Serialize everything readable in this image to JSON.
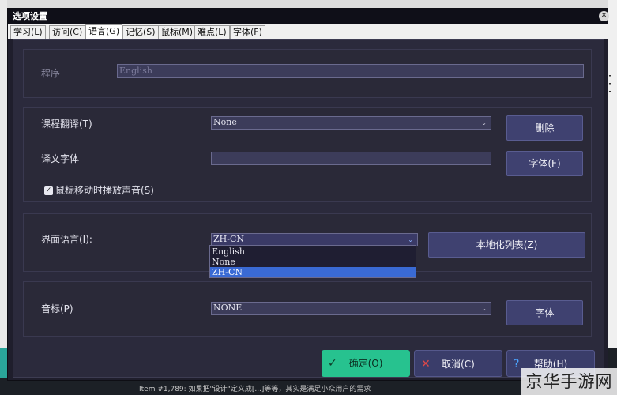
{
  "dialog": {
    "title": "选项设置"
  },
  "tabs": [
    {
      "label": "学习(L)"
    },
    {
      "label": "访问(C)"
    },
    {
      "label": "语言(G)",
      "active": true
    },
    {
      "label": "记忆(S)"
    },
    {
      "label": "鼠标(M)"
    },
    {
      "label": "难点(L)"
    },
    {
      "label": "字体(F)"
    }
  ],
  "program": {
    "label": "程序",
    "value": "English"
  },
  "translation": {
    "course_label": "课程翻译(T)",
    "course_value": "None",
    "delete_button": "删除",
    "font_label": "译文字体",
    "font_value": "",
    "font_button": "字体(F)",
    "hover_sound_label": "鼠标移动时播放声音(S)",
    "hover_sound_checked": true
  },
  "ui_language": {
    "label": "界面语言(I):",
    "value": "ZH-CN",
    "localize_button": "本地化列表(Z)",
    "options": [
      "English",
      "None",
      "ZH-CN"
    ],
    "selected_index": 2
  },
  "phonetic": {
    "label": "音标(P)",
    "value": "NONE",
    "font_button": "字体"
  },
  "footer": {
    "ok": "确定(O)",
    "cancel": "取消(C)",
    "help": "帮助(H)"
  },
  "background": {
    "status_text": "Item #1,789: 如果把\"设计\"定义成[...]等等，其实是满足小众用户的需求",
    "watermark": "京华手游网"
  },
  "colors": {
    "dialog_bg": "#1f1e2c",
    "panel_bg": "#2b2a3c",
    "button_bg": "#3f4170",
    "ok_green": "#27c28f",
    "selection": "#3a6ad4"
  }
}
